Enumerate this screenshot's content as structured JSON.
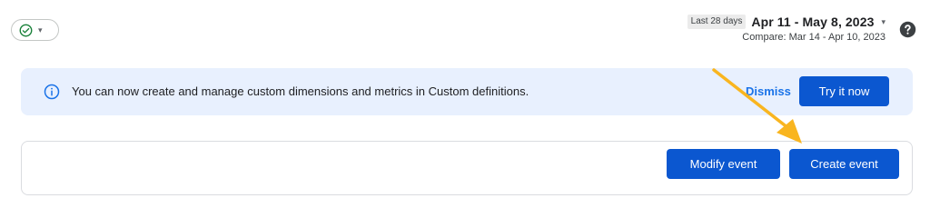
{
  "status_chip": {
    "icon": "check-circle-icon",
    "caret": "▾"
  },
  "date_range": {
    "badge": "Last 28 days",
    "range": "Apr 11 - May 8, 2023",
    "caret": "▾",
    "compare": "Compare: Mar 14 - Apr 10, 2023"
  },
  "help": {
    "icon": "help-icon"
  },
  "banner": {
    "icon": "info-icon",
    "message": "You can now create and manage custom dimensions and metrics in Custom definitions.",
    "dismiss_label": "Dismiss",
    "try_label": "Try it now"
  },
  "actions": {
    "modify_label": "Modify event",
    "create_label": "Create event"
  },
  "colors": {
    "primary": "#0b57d0",
    "banner_bg": "#e8f0fe",
    "success": "#188038",
    "annotation_arrow": "#f9b51f"
  }
}
